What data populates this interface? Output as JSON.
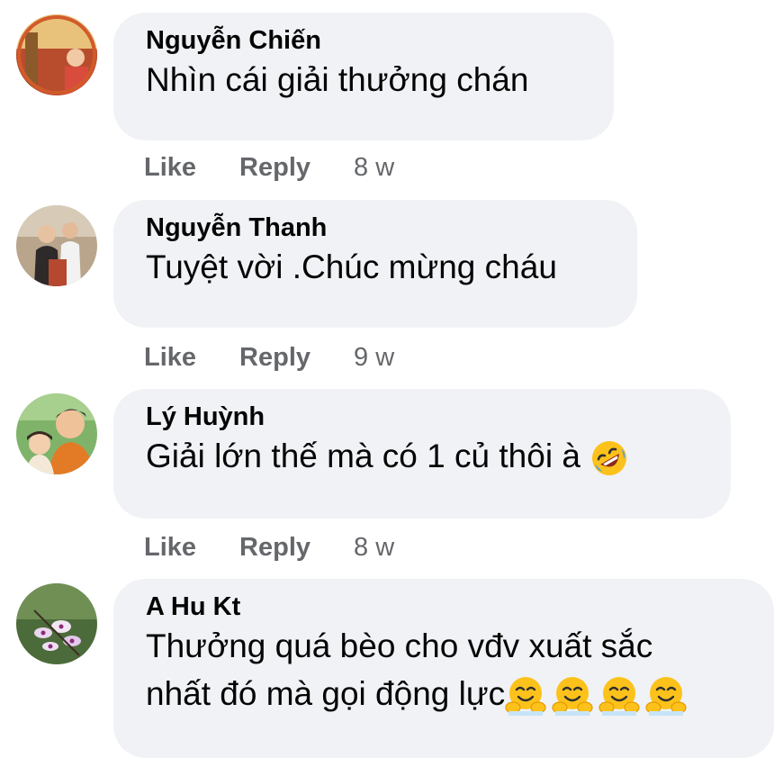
{
  "comments": [
    {
      "author": "Nguyễn Chiến",
      "text": "Nhìn cái giải thưởng chán",
      "actions": {
        "like": "Like",
        "reply": "Reply",
        "time": "8 w"
      },
      "avatar_icon": "user-photo-avatar"
    },
    {
      "author": "Nguyễn Thanh",
      "text": "Tuyệt vời .Chúc mừng cháu",
      "actions": {
        "like": "Like",
        "reply": "Reply",
        "time": "9 w"
      },
      "avatar_icon": "user-photo-avatar"
    },
    {
      "author": "Lý Huỳnh",
      "text": "Giải lớn thế mà có 1 củ thôi à",
      "text_emoji": "rolling-on-floor-laughing-emoji",
      "actions": {
        "like": "Like",
        "reply": "Reply",
        "time": "8 w"
      },
      "avatar_icon": "user-photo-avatar"
    },
    {
      "author": "A Hu Kt",
      "text_line1": "Thưởng quá bèo cho vđv xuất sắc",
      "text_line2": "nhất đó mà gọi động lực",
      "text_emoji": "smiling-face-with-open-hands-emoji",
      "avatar_icon": "orchid-photo-avatar"
    }
  ],
  "colors": {
    "bubble_bg": "#f0f2f5",
    "text": "#050505",
    "secondary_text": "#65676b"
  }
}
